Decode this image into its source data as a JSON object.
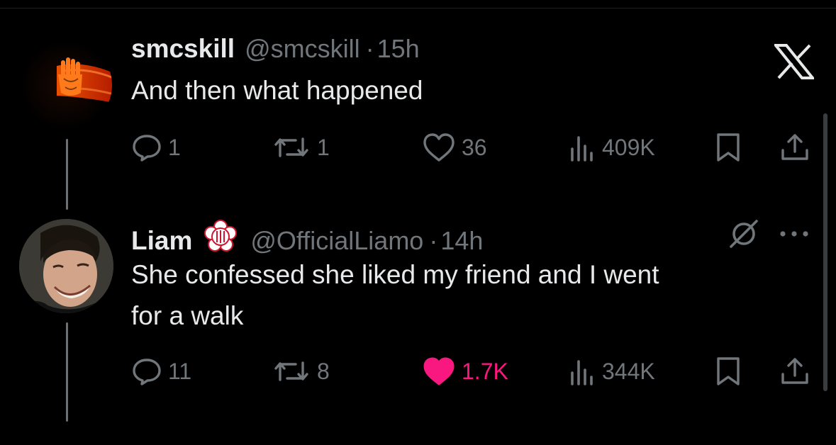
{
  "tweets": [
    {
      "name": "smcskill",
      "handle": "@smcskill",
      "separator": "·",
      "time": "15h",
      "text": "And then what happened",
      "replies": "1",
      "reposts": "1",
      "likes": "36",
      "views": "409K",
      "liked": false
    },
    {
      "name": "Liam",
      "handle": "@OfficialLiamo",
      "separator": "·",
      "time": "14h",
      "text_line1": "She confessed she liked my friend and I went",
      "text_line2": "for a walk",
      "replies": "11",
      "reposts": "8",
      "likes": "1.7K",
      "views": "344K",
      "liked": true
    }
  ],
  "icons": [
    "x-logo-icon",
    "reply-icon",
    "repost-icon",
    "like-icon",
    "views-icon",
    "bookmark-icon",
    "share-icon",
    "grok-icon",
    "more-icon",
    "verified-badge-icon"
  ],
  "colors": {
    "background": "#000000",
    "text": "#e7e9ea",
    "muted": "#71767b",
    "like": "#f91880"
  }
}
